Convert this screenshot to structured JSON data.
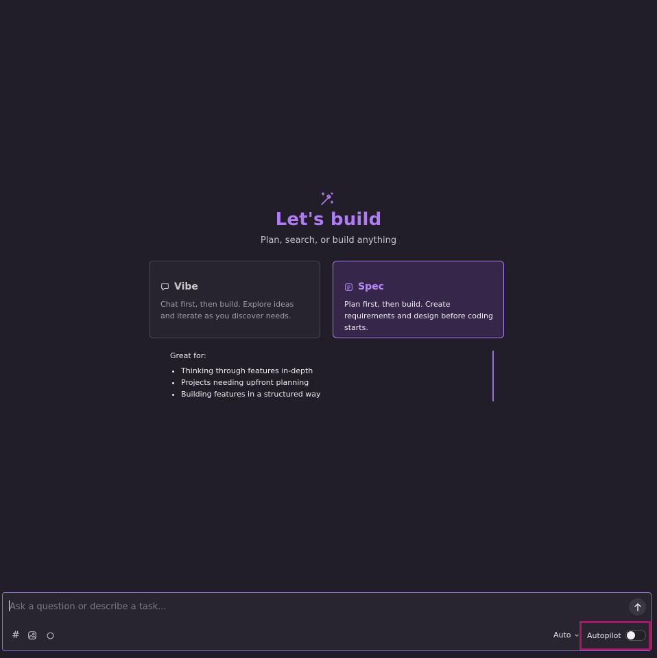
{
  "hero": {
    "icon": "magic-wand-icon",
    "title": "Let's build",
    "subtitle": "Plan, search, or build anything"
  },
  "modes": [
    {
      "icon": "chat-bubble-icon",
      "title": "Vibe",
      "description": "Chat first, then build. Explore ideas and iterate as you discover needs.",
      "selected": false
    },
    {
      "icon": "document-list-icon",
      "title": "Spec",
      "description": "Plan first, then build. Create requirements and design before coding starts.",
      "selected": true
    }
  ],
  "great_for": {
    "label": "Great for:",
    "items": [
      "Thinking through features in-depth",
      "Projects needing upfront planning",
      "Building features in a structured way"
    ]
  },
  "composer": {
    "placeholder": "Ask a question or describe a task...",
    "value": "",
    "tools": [
      "hash-icon",
      "image-icon",
      "circle-icon"
    ],
    "send_icon": "arrow-up-icon",
    "model": "Auto",
    "autopilot_label": "Autopilot",
    "autopilot_on": false
  },
  "colors": {
    "background": "#211e27",
    "accent": "#b07cf5",
    "highlight_box": "#a5196a"
  }
}
